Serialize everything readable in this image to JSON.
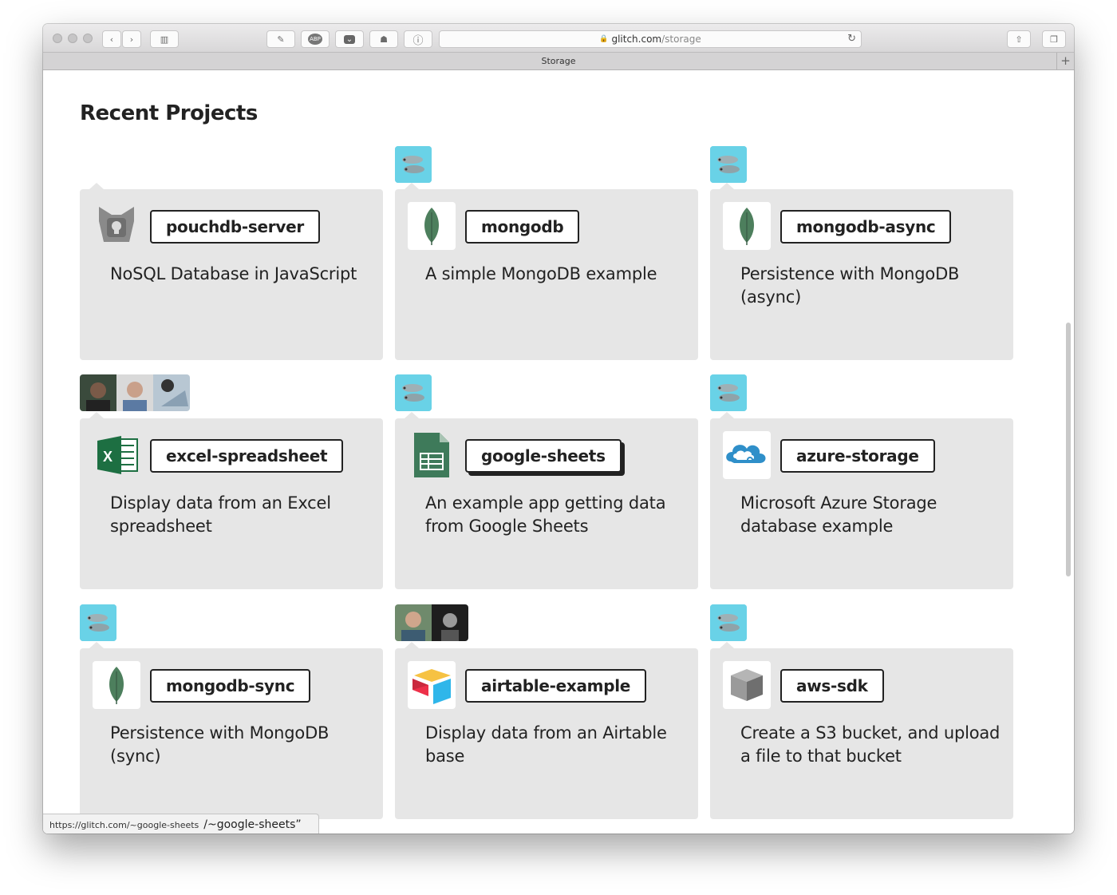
{
  "browser": {
    "url_host": "glitch.com",
    "url_path": "/storage",
    "tab_title": "Storage",
    "new_tab_label": "+",
    "toolbar_buttons": [
      {
        "name": "back-button",
        "glyph": "‹"
      },
      {
        "name": "forward-button",
        "glyph": "›"
      },
      {
        "name": "sidebar-button",
        "glyph": "▥"
      },
      {
        "name": "css-extension-button",
        "glyph": "✎"
      },
      {
        "name": "adblock-extension-button",
        "glyph": "ABP"
      },
      {
        "name": "pocket-extension-button",
        "glyph": "⌄"
      },
      {
        "name": "ghostery-extension-button",
        "glyph": "☗"
      },
      {
        "name": "info-extension-button",
        "glyph": "ⓘ"
      }
    ]
  },
  "page": {
    "heading": "Recent Projects"
  },
  "projects": [
    {
      "name": "pouchdb-server",
      "description": "NoSQL Database in JavaScript",
      "icon": "pouchdb-icon",
      "owner": "none"
    },
    {
      "name": "mongodb",
      "description": "A simple MongoDB example",
      "icon": "mongodb-leaf-icon",
      "owner": "team"
    },
    {
      "name": "mongodb-async",
      "description": "Persistence with MongoDB (async)",
      "icon": "mongodb-leaf-icon",
      "owner": "team"
    },
    {
      "name": "excel-spreadsheet",
      "description": "Display data from an Excel spreadsheet",
      "icon": "excel-icon",
      "owner": "users"
    },
    {
      "name": "google-sheets",
      "description": "An example app getting data from Google Sheets",
      "icon": "google-sheets-icon",
      "owner": "team"
    },
    {
      "name": "azure-storage",
      "description": "Microsoft Azure Storage database example",
      "icon": "azure-cloud-icon",
      "owner": "team"
    },
    {
      "name": "mongodb-sync",
      "description": "Persistence with MongoDB (sync)",
      "icon": "mongodb-leaf-icon",
      "owner": "team"
    },
    {
      "name": "airtable-example",
      "description": "Display data from an Airtable base",
      "icon": "airtable-icon",
      "owner": "users"
    },
    {
      "name": "aws-sdk",
      "description": "Create a S3 bucket, and upload a file to that bucket",
      "icon": "aws-cube-icon",
      "owner": "team"
    }
  ],
  "status_bar": {
    "link_url": "https://glitch.com/~google-sheets",
    "link_text": "/~google-sheets”"
  },
  "colors": {
    "card_bg": "#e6e6e6",
    "team_badge": "#69d2e7",
    "mongodb_leaf": "#4d7f5d",
    "excel_green": "#1d6f42",
    "sheets_green": "#3e7a5a",
    "azure_blue": "#2f8fc9"
  }
}
